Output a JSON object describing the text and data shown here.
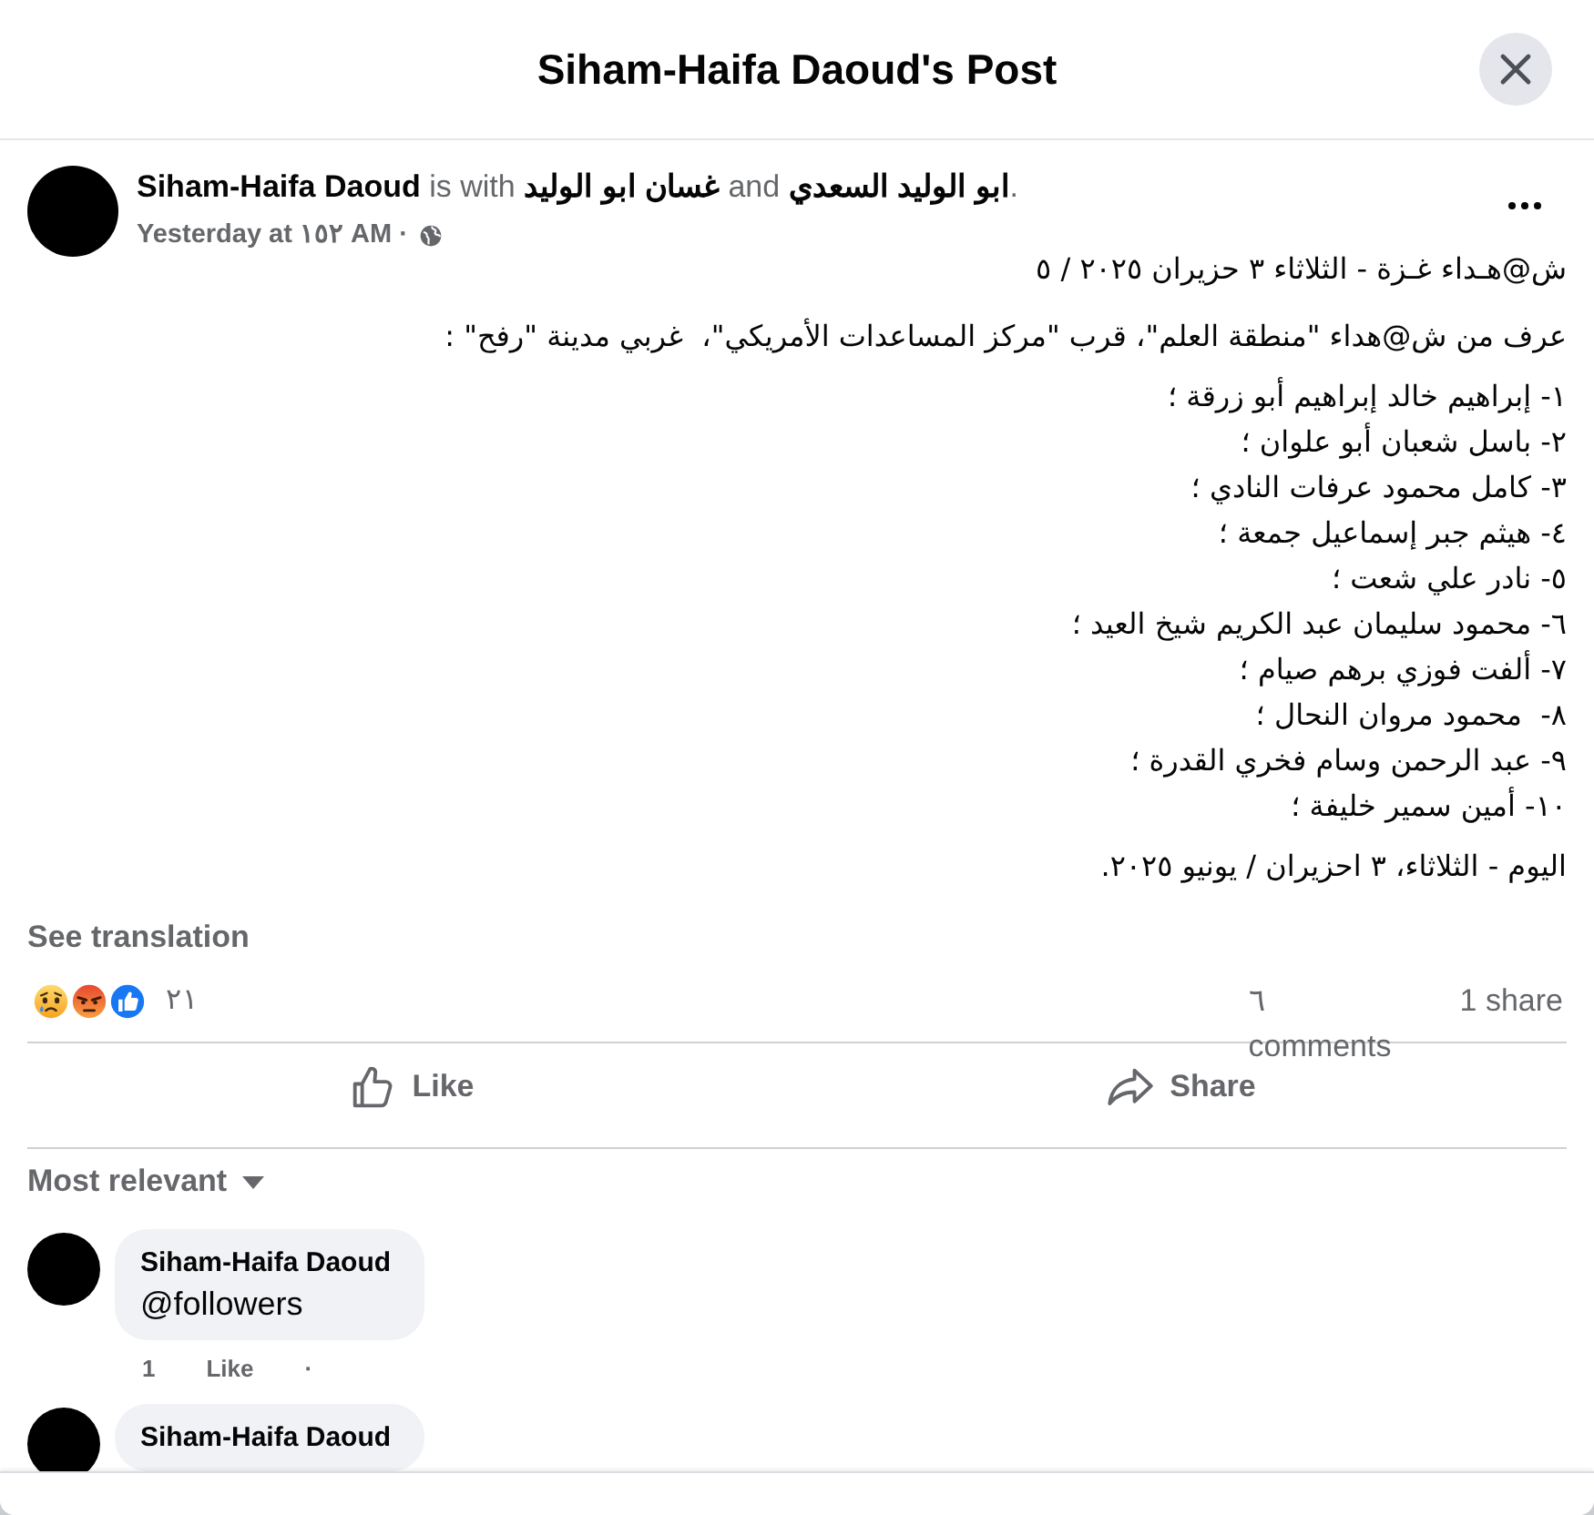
{
  "window": {
    "title": "Siham-Haifa Daoud's Post"
  },
  "post": {
    "author_line": "**Siham-Haifa Daoud** is with **غسان ابو الوليد** and **ابو الوليد السعدي**.",
    "timestamp": "Yesterday at ١٥٢ AM ·",
    "headline": "ش@هـداء غـزة - الثلاثاء ٣ حزيران ٢٠٢٥ / ٥",
    "intro": "عرف من ش@هداء \"منطقة العلم\"، قرب \"مركز المساعدات الأمريكي\"،  غربي مدينة \"رفح\" :",
    "list": [
      "١- إبراهيم خالد إبراهيم أبو زرقة ؛",
      "٢- باسل شعبان أبو علوان ؛",
      "٣- كامل محمود عرفات النادي ؛",
      "٤- هيثم جبر إسماعيل جمعة ؛",
      "٥- نادر علي شعت ؛",
      "٦- محمود سليمان عبد الكريم شيخ العيد ؛",
      "٧- ألفت فوزي برهم صيام ؛",
      "٨-  محمود مروان النحال ؛",
      "٩- عبد الرحمن وسام فخري القدرة ؛",
      "١٠- أمين سمير خليفة ؛"
    ],
    "closing": "اليوم - الثلاثاء، ٣ احزيران / يونيو ٢٠٢٥.",
    "see_translation": "See translation",
    "reactions": [
      {
        "kind": "sad"
      },
      {
        "kind": "angry"
      },
      {
        "kind": "like"
      }
    ],
    "reaction_count": "٢١",
    "comment_count": "٦ comments",
    "share_count": "1 share",
    "like_button": "Like",
    "share_button": "Share"
  },
  "comments": {
    "sort_label": "Most relevant",
    "items": [
      {
        "author": "Siham-Haifa Daoud",
        "text": "@followers",
        "time": "1",
        "like": "Like",
        "separator": "·"
      },
      {
        "author": "Siham-Haifa Daoud"
      }
    ]
  }
}
